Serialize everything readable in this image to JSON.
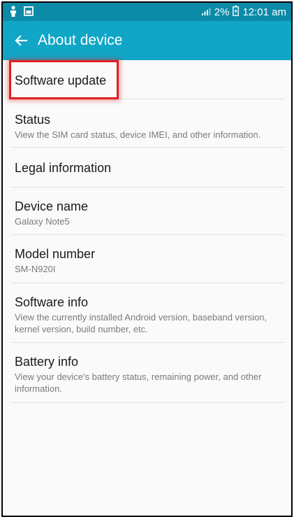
{
  "status_bar": {
    "battery_percent": "2%",
    "time": "12:01 am"
  },
  "app_bar": {
    "title": "About device"
  },
  "items": [
    {
      "title": "Software update"
    },
    {
      "title": "Status",
      "subtitle": "View the SIM card status, device IMEI, and other information."
    },
    {
      "title": "Legal information"
    },
    {
      "title": "Device name",
      "subtitle": "Galaxy Note5"
    },
    {
      "title": "Model number",
      "subtitle": "SM-N920I"
    },
    {
      "title": "Software info",
      "subtitle": "View the currently installed Android version, baseband version, kernel version, build number, etc."
    },
    {
      "title": "Battery info",
      "subtitle": "View your device's battery status, remaining power, and other information."
    }
  ],
  "colors": {
    "status_bar": "#0b8ba8",
    "app_bar": "#11a6c6",
    "highlight": "#e02020"
  },
  "icons": {
    "status_left": [
      "person-icon",
      "image-icon"
    ],
    "status_right": [
      "signal-icon",
      "battery-icon"
    ],
    "app_bar": "back-arrow-icon"
  }
}
